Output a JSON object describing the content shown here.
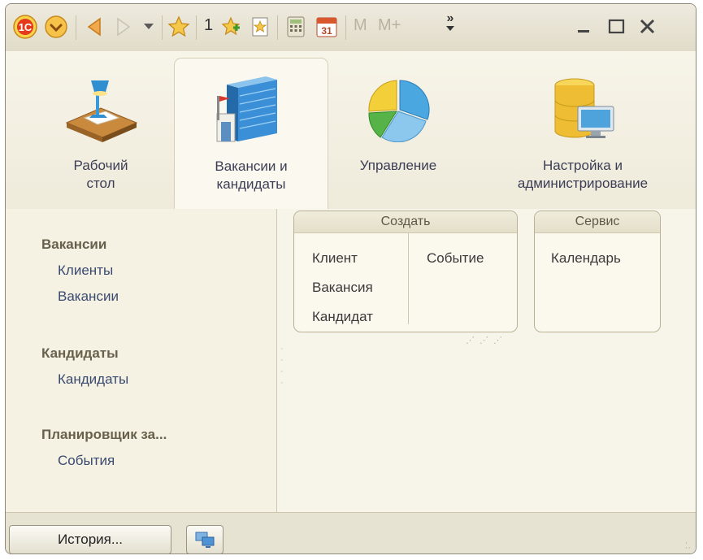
{
  "toolbar": {
    "icons": [
      "1c-logo-icon",
      "main-menu-icon",
      "back-icon",
      "forward-icon",
      "history-dropdown-icon",
      "favorites-star-icon",
      "add-to-favorites-icon",
      "bookmark-icon",
      "calculator-icon",
      "calendar-icon",
      "memory-m-icon",
      "memory-m-plus-icon",
      "overflow-menu-icon",
      "minimize-icon",
      "maximize-icon",
      "close-icon"
    ],
    "count_badge": "1",
    "calendar_day": "31",
    "m_label": "M",
    "m_plus_label": "M+",
    "more_label": "»"
  },
  "sections": [
    {
      "label": "Рабочий стол",
      "line1": "Рабочий",
      "line2": "стол",
      "icon": "desk-lamp-icon"
    },
    {
      "label": "Вакансии и кандидаты",
      "line1": "Вакансии и",
      "line2": "кандидаты",
      "icon": "office-building-icon",
      "active": true
    },
    {
      "label": "Управление",
      "line1": "Управление",
      "line2": "",
      "icon": "pie-chart-icon"
    },
    {
      "label": "Настройка и администрирование",
      "line1": "Настройка и",
      "line2": "администрирование",
      "icon": "database-monitor-icon"
    }
  ],
  "nav": {
    "groups": [
      {
        "title": "Вакансии",
        "items": [
          "Клиенты",
          "Вакансии"
        ]
      },
      {
        "title": "Кандидаты",
        "items": [
          "Кандидаты"
        ]
      },
      {
        "title": "Планировщик за...",
        "items": [
          "События"
        ]
      }
    ]
  },
  "create_panel": {
    "title": "Создать",
    "left_items": [
      "Клиент",
      "Вакансия",
      "Кандидат"
    ],
    "right_items": [
      "Событие"
    ]
  },
  "service_panel": {
    "title": "Сервис",
    "items": [
      "Календарь"
    ]
  },
  "bottom": {
    "history_label": "История...",
    "windows_icon": "windows-switch-icon"
  },
  "colors": {
    "window_bg": "#f2efdf",
    "nav_link": "#3a4a70",
    "nav_group": "#66604c"
  }
}
